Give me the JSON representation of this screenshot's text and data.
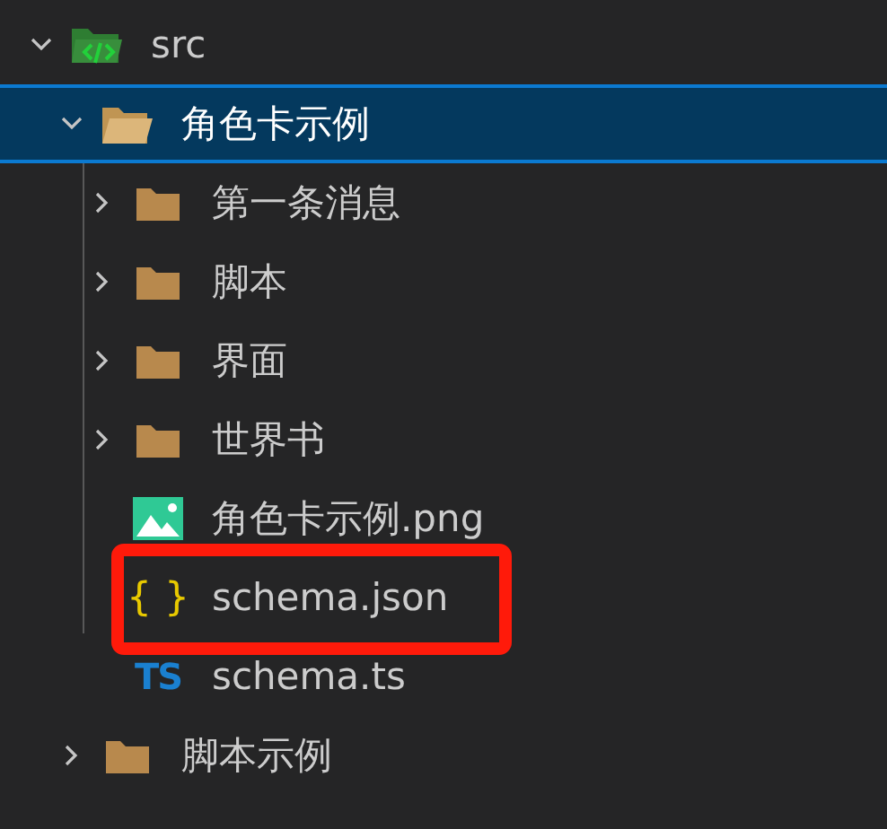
{
  "tree": [
    {
      "name": "src",
      "kind": "source-folder",
      "expanded": true,
      "selected": false,
      "children": [
        {
          "name": "角色卡示例",
          "kind": "folder",
          "expanded": true,
          "selected": true,
          "children": [
            {
              "name": "第一条消息",
              "kind": "folder",
              "expanded": false,
              "selected": false
            },
            {
              "name": "脚本",
              "kind": "folder",
              "expanded": false,
              "selected": false
            },
            {
              "name": "界面",
              "kind": "folder",
              "expanded": false,
              "selected": false
            },
            {
              "name": "世界书",
              "kind": "folder",
              "expanded": false,
              "selected": false
            },
            {
              "name": "角色卡示例.png",
              "kind": "image",
              "selected": false
            },
            {
              "name": "schema.json",
              "kind": "json",
              "icon_text": "{ }",
              "selected": false,
              "highlighted": true
            },
            {
              "name": "schema.ts",
              "kind": "ts",
              "icon_text": "TS",
              "selected": false
            }
          ]
        },
        {
          "name": "脚本示例",
          "kind": "folder",
          "expanded": false,
          "selected": false
        }
      ]
    }
  ]
}
